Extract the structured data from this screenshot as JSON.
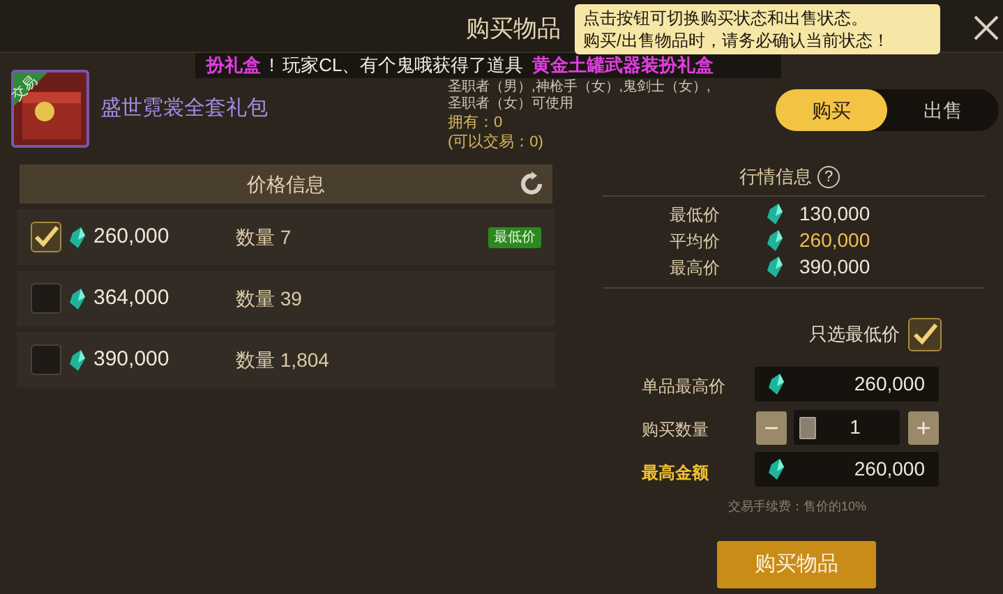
{
  "window": {
    "title": "购买物品"
  },
  "broadcast": [
    {
      "text": "扮礼盒",
      "highlight": true
    },
    {
      "text": "!",
      "highlight": false
    },
    {
      "text": "玩家CL、有个鬼哦获得了道具",
      "highlight": false
    },
    {
      "text": "黄金土罐武器装扮礼盒",
      "highlight": true
    }
  ],
  "tooltip": [
    "点击按钮可切换购买状态和出售状态。",
    "购买/出售物品时，请务必确认当前状态！"
  ],
  "item": {
    "badge": "交易",
    "name": "盛世霓裳全套礼包",
    "details": [
      "圣职者（男）,神枪手（女）,鬼剑士（女）,",
      "圣职者（女）可使用"
    ],
    "owned": "拥有：0",
    "tradable": "(可以交易：0)"
  },
  "mode_tabs": [
    {
      "label": "购买",
      "selected": true
    },
    {
      "label": "出售",
      "selected": false
    }
  ],
  "price_list": {
    "header": "价格信息",
    "rows": [
      {
        "price": "260,000",
        "quantity": "数量 7",
        "badge": "最低价",
        "checked": true
      },
      {
        "price": "364,000",
        "quantity": "数量 39",
        "checked": false
      },
      {
        "price": "390,000",
        "quantity": "数量 1,804",
        "checked": false
      }
    ]
  },
  "market": {
    "title": "行情信息",
    "help": "?",
    "stats": [
      {
        "label": "最低价",
        "value": "130,000",
        "highlight": false
      },
      {
        "label": "平均价",
        "value": "260,000",
        "highlight": true
      },
      {
        "label": "最高价",
        "value": "390,000",
        "highlight": false
      }
    ]
  },
  "lowest_only": {
    "label": "只选最低价",
    "checked": true
  },
  "form": {
    "unit_max_label": "单品最高价",
    "unit_max": "260,000",
    "quantity_label": "购买数量",
    "quantity": "1",
    "minus": "−",
    "plus": "+",
    "total_label": "最高金额",
    "total": "260,000",
    "fee_note": "交易手续费：售价的10%"
  },
  "buy_button": "购买物品"
}
